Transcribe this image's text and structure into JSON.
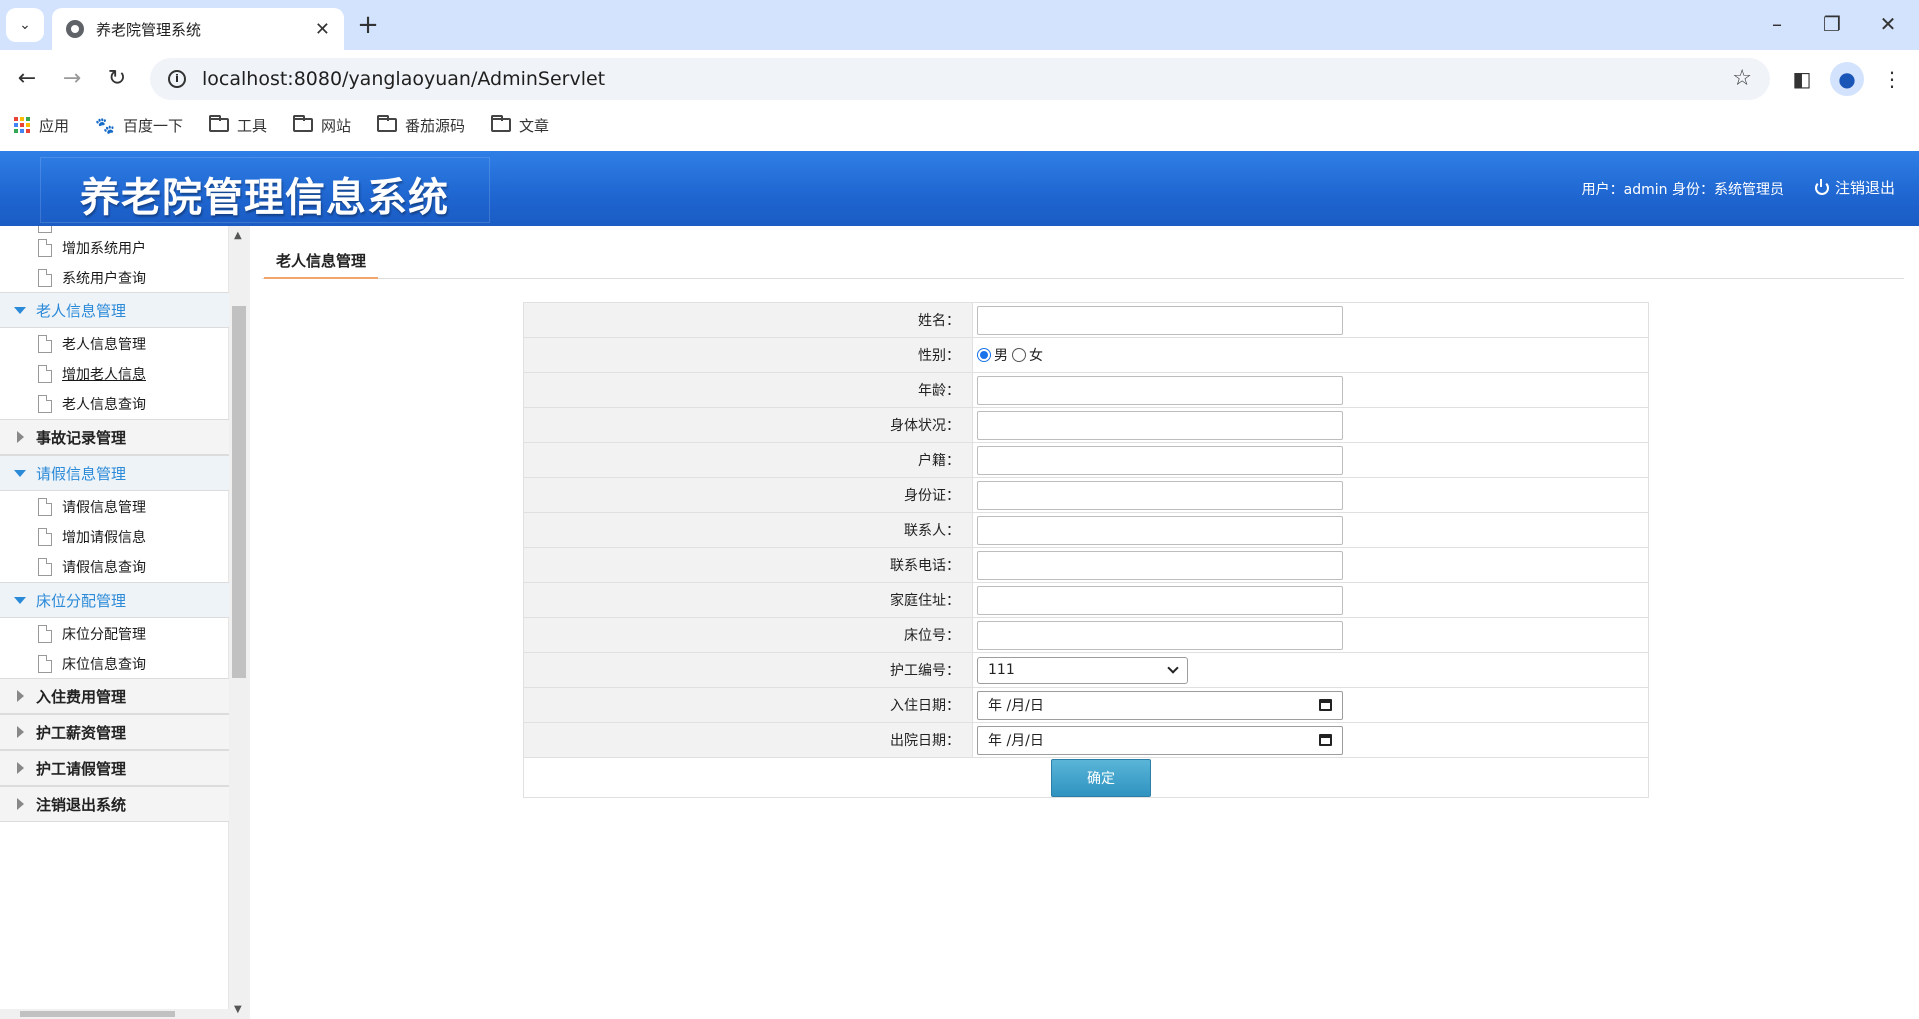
{
  "browser": {
    "tab_title": "养老院管理系统",
    "url": "localhost:8080/yanglaoyuan/AdminServlet",
    "bookmarks": [
      {
        "label": "应用",
        "icon": "apps-grid-icon"
      },
      {
        "label": "百度一下",
        "icon": "baidu-paw-icon"
      },
      {
        "label": "工具",
        "icon": "folder-icon"
      },
      {
        "label": "网站",
        "icon": "folder-icon"
      },
      {
        "label": "番茄源码",
        "icon": "folder-icon"
      },
      {
        "label": "文章",
        "icon": "folder-icon"
      }
    ]
  },
  "header": {
    "title": "养老院管理信息系统",
    "user_info": "用户：admin 身份：系统管理员",
    "logout": "注销退出"
  },
  "sidebar": {
    "sys_items": [
      "增加系统用户",
      "系统用户查询"
    ],
    "groups": [
      {
        "label": "老人信息管理",
        "open": true,
        "items": [
          "老人信息管理",
          "增加老人信息",
          "老人信息查询"
        ]
      },
      {
        "label": "事故记录管理",
        "open": false,
        "items": []
      },
      {
        "label": "请假信息管理",
        "open": true,
        "items": [
          "请假信息管理",
          "增加请假信息",
          "请假信息查询"
        ]
      },
      {
        "label": "床位分配管理",
        "open": true,
        "items": [
          "床位分配管理",
          "床位信息查询"
        ]
      },
      {
        "label": "入住费用管理",
        "open": false,
        "items": []
      },
      {
        "label": "护工薪资管理",
        "open": false,
        "items": []
      },
      {
        "label": "护工请假管理",
        "open": false,
        "items": []
      },
      {
        "label": "注销退出系统",
        "open": false,
        "items": []
      }
    ]
  },
  "content": {
    "tab": "老人信息管理",
    "form": {
      "name_label": "姓名：",
      "gender_label": "性别：",
      "gender_options": [
        "男",
        "女"
      ],
      "gender_selected": "男",
      "age_label": "年龄：",
      "health_label": "身体状况：",
      "hukou_label": "户籍：",
      "idcard_label": "身份证：",
      "contact_label": "联系人：",
      "phone_label": "联系电话：",
      "address_label": "家庭住址：",
      "bed_label": "床位号：",
      "nurse_label": "护工编号：",
      "nurse_value": "111",
      "checkin_label": "入住日期：",
      "checkin_value": "年 /月/日",
      "checkout_label": "出院日期：",
      "checkout_value": "年 /月/日",
      "submit": "确定"
    }
  },
  "colors": {
    "header_blue": "#1f66d1",
    "accent_blue": "#2b8ad8",
    "button": "#3a9bc6"
  }
}
